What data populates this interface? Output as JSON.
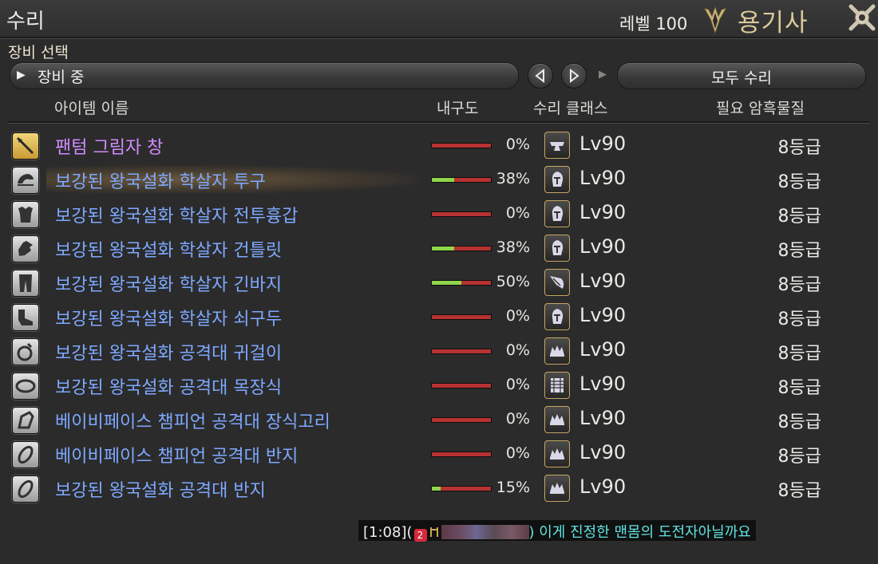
{
  "window": {
    "title": "수리"
  },
  "header": {
    "level": "레벨 100",
    "job": "용기사",
    "emblem_icon": "dragoon-emblem-icon",
    "settings_icon": "crossed-tools-icon"
  },
  "section": {
    "label": "장비 선택"
  },
  "toolbar": {
    "dropdown_arrow": "▶",
    "dropdown_value": "장비 중",
    "marker": "▶",
    "repair_all_label": "모두 수리"
  },
  "columns": {
    "name": "아이템 이름",
    "durability": "내구도",
    "repair_class": "수리 클래스",
    "materia": "필요 암흑물질"
  },
  "items": [
    {
      "icon": "spear-icon",
      "name": "팬텀 그림자 창",
      "durability": "0%",
      "fill": 0,
      "class_icon": "blacksmith-icon",
      "level": "Lv90",
      "grade": "8등급",
      "color": "purple"
    },
    {
      "icon": "head-icon",
      "name": "보강된 왕국설화 학살자 투구",
      "durability": "38%",
      "fill": 0.38,
      "class_icon": "armorer-icon",
      "level": "Lv90",
      "grade": "8등급",
      "color": "blue",
      "highlight": true
    },
    {
      "icon": "body-icon",
      "name": "보강된 왕국설화 학살자 전투흉갑",
      "durability": "0%",
      "fill": 0,
      "class_icon": "armorer-icon",
      "level": "Lv90",
      "grade": "8등급",
      "color": "blue"
    },
    {
      "icon": "hands-icon",
      "name": "보강된 왕국설화 학살자 건틀릿",
      "durability": "38%",
      "fill": 0.38,
      "class_icon": "armorer-icon",
      "level": "Lv90",
      "grade": "8등급",
      "color": "blue"
    },
    {
      "icon": "legs-icon",
      "name": "보강된 왕국설화 학살자 긴바지",
      "durability": "50%",
      "fill": 0.5,
      "class_icon": "leatherworker-icon",
      "level": "Lv90",
      "grade": "8등급",
      "color": "blue"
    },
    {
      "icon": "feet-icon",
      "name": "보강된 왕국설화 학살자 쇠구두",
      "durability": "0%",
      "fill": 0,
      "class_icon": "armorer-icon",
      "level": "Lv90",
      "grade": "8등급",
      "color": "blue"
    },
    {
      "icon": "earring-icon",
      "name": "보강된 왕국설화 공격대 귀걸이",
      "durability": "0%",
      "fill": 0,
      "class_icon": "goldsmith-icon",
      "level": "Lv90",
      "grade": "8등급",
      "color": "blue"
    },
    {
      "icon": "necklace-icon",
      "name": "보강된 왕국설화 공격대 목장식",
      "durability": "0%",
      "fill": 0,
      "class_icon": "weaver-icon",
      "level": "Lv90",
      "grade": "8등급",
      "color": "blue"
    },
    {
      "icon": "bracelet-icon",
      "name": "베이비페이스 챔피언 공격대 장식고리",
      "durability": "0%",
      "fill": 0,
      "class_icon": "goldsmith-icon",
      "level": "Lv90",
      "grade": "8등급",
      "color": "blue"
    },
    {
      "icon": "ring-icon",
      "name": "베이비페이스 챔피언 공격대 반지",
      "durability": "0%",
      "fill": 0,
      "class_icon": "goldsmith-icon",
      "level": "Lv90",
      "grade": "8등급",
      "color": "blue"
    },
    {
      "icon": "ring-icon",
      "name": "보강된 왕국설화 공격대 반지",
      "durability": "15%",
      "fill": 0.15,
      "class_icon": "goldsmith-icon",
      "level": "Lv90",
      "grade": "8등급",
      "color": "blue"
    }
  ],
  "chat": {
    "timestamp": "[1:08]",
    "open": "(",
    "world_badge": "2",
    "message": ") 이게 진정한 맨몸의 도전자아닐까요"
  },
  "colors": {
    "item_blue": "#7ea8ff",
    "item_purple": "#d18cff",
    "chat_cyan": "#61e3e0",
    "durability_green": "#8fd64a",
    "durability_red": "#b73232",
    "job_gold": "#d9c99a"
  }
}
